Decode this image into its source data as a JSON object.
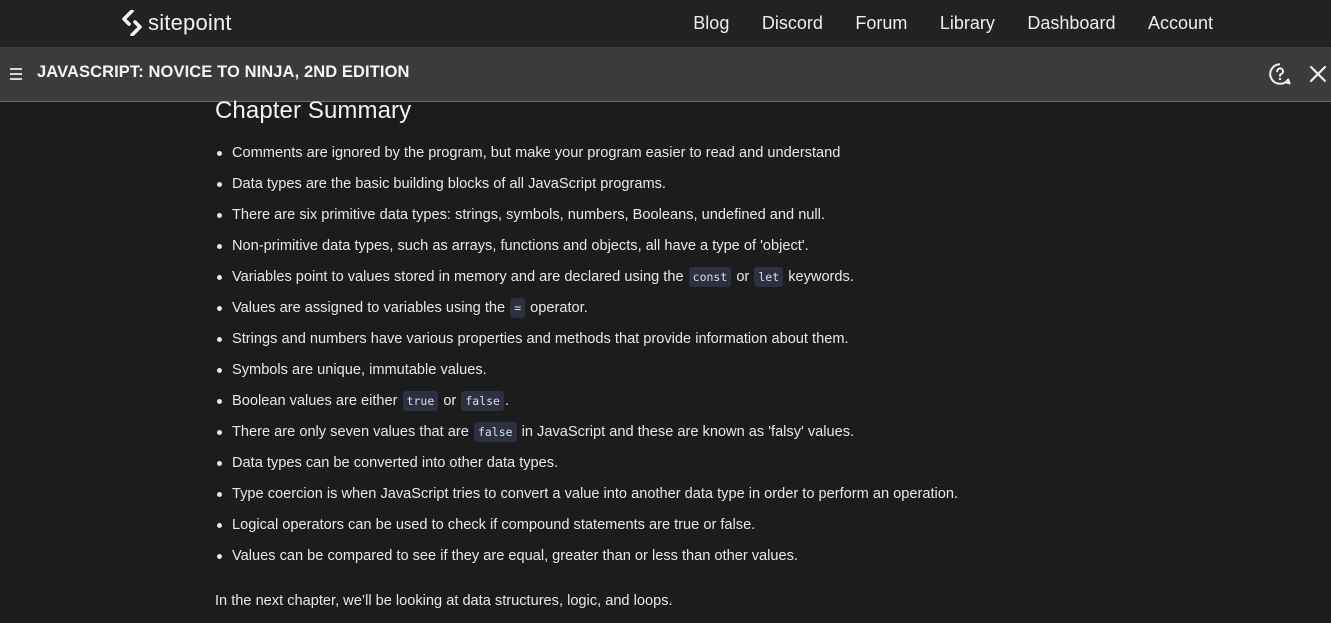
{
  "site": {
    "logo_text": "sitepoint",
    "nav": [
      "Blog",
      "Discord",
      "Forum",
      "Library",
      "Dashboard",
      "Account"
    ]
  },
  "book": {
    "title": "JAVASCRIPT: NOVICE TO NINJA, 2ND EDITION"
  },
  "content": {
    "heading": "Chapter Summary",
    "items": [
      [
        {
          "t": "Comments are ignored by the program, but make your program easier to read and understand"
        }
      ],
      [
        {
          "t": "Data types are the basic building blocks of all JavaScript programs."
        }
      ],
      [
        {
          "t": "There are six primitive data types: strings, symbols, numbers, Booleans, undefined and null."
        }
      ],
      [
        {
          "t": "Non-primitive data types, such as arrays, functions and objects, all have a type of 'object'."
        }
      ],
      [
        {
          "t": "Variables point to values stored in memory and are declared using the "
        },
        {
          "c": "const"
        },
        {
          "t": " or "
        },
        {
          "c": "let"
        },
        {
          "t": " keywords."
        }
      ],
      [
        {
          "t": "Values are assigned to variables using the "
        },
        {
          "c": "="
        },
        {
          "t": " operator."
        }
      ],
      [
        {
          "t": "Strings and numbers have various properties and methods that provide information about them."
        }
      ],
      [
        {
          "t": "Symbols are unique, immutable values."
        }
      ],
      [
        {
          "t": "Boolean values are either "
        },
        {
          "c": "true"
        },
        {
          "t": " or "
        },
        {
          "c": "false"
        },
        {
          "t": "."
        }
      ],
      [
        {
          "t": "There are only seven values that are "
        },
        {
          "c": "false"
        },
        {
          "t": " in JavaScript and these are known as 'falsy' values."
        }
      ],
      [
        {
          "t": "Data types can be converted into other data types."
        }
      ],
      [
        {
          "t": "Type coercion is when JavaScript tries to convert a value into another data type in order to perform an operation."
        }
      ],
      [
        {
          "t": "Logical operators can be used to check if compound statements are true or false."
        }
      ],
      [
        {
          "t": "Values can be compared to see if they are equal, greater than or less than other values."
        }
      ]
    ],
    "next_chapter": "In the next chapter, we’ll be looking at data structures, logic, and loops."
  },
  "icons": {
    "logo": "sitepoint-logo-icon",
    "menu": "hamburger-menu-icon",
    "help": "help-question-icon",
    "close": "close-icon"
  },
  "colors": {
    "background": "#1c1c1d",
    "topnav": "#222223",
    "bookbar": "#3b3b3e",
    "code_bg": "#2c3040"
  }
}
